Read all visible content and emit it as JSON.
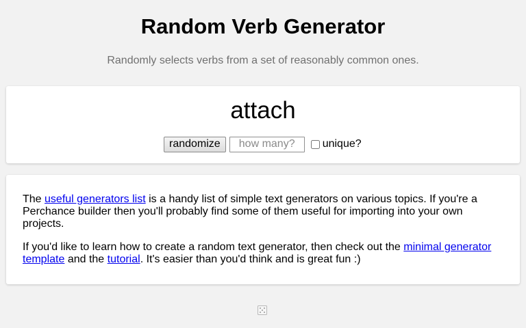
{
  "header": {
    "title": "Random Verb Generator",
    "subtitle": "Randomly selects verbs from a set of reasonably common ones."
  },
  "output": {
    "word": "attach",
    "randomize_label": "randomize",
    "count_placeholder": "how many?",
    "count_value": "",
    "unique_label": "unique?",
    "unique_checked": false
  },
  "info": {
    "p1_text_1": "The ",
    "p1_link": "useful generators list",
    "p1_text_2": " is a handy list of simple text generators on various topics. If you're a Perchance builder then you'll probably find some of them useful for importing into your own projects.",
    "p2_text_1": "If you'd like to learn how to create a random text generator, then check out the ",
    "p2_link_1": "minimal generator template",
    "p2_text_2": " and the ",
    "p2_link_2": "tutorial",
    "p2_text_3": ". It's easier than you'd think and is great fun :)"
  },
  "footer": {
    "icon": "dice-icon"
  },
  "colors": {
    "background": "#f2f2f2",
    "card": "#ffffff",
    "link": "#0000ee",
    "subtitle": "#707070"
  }
}
